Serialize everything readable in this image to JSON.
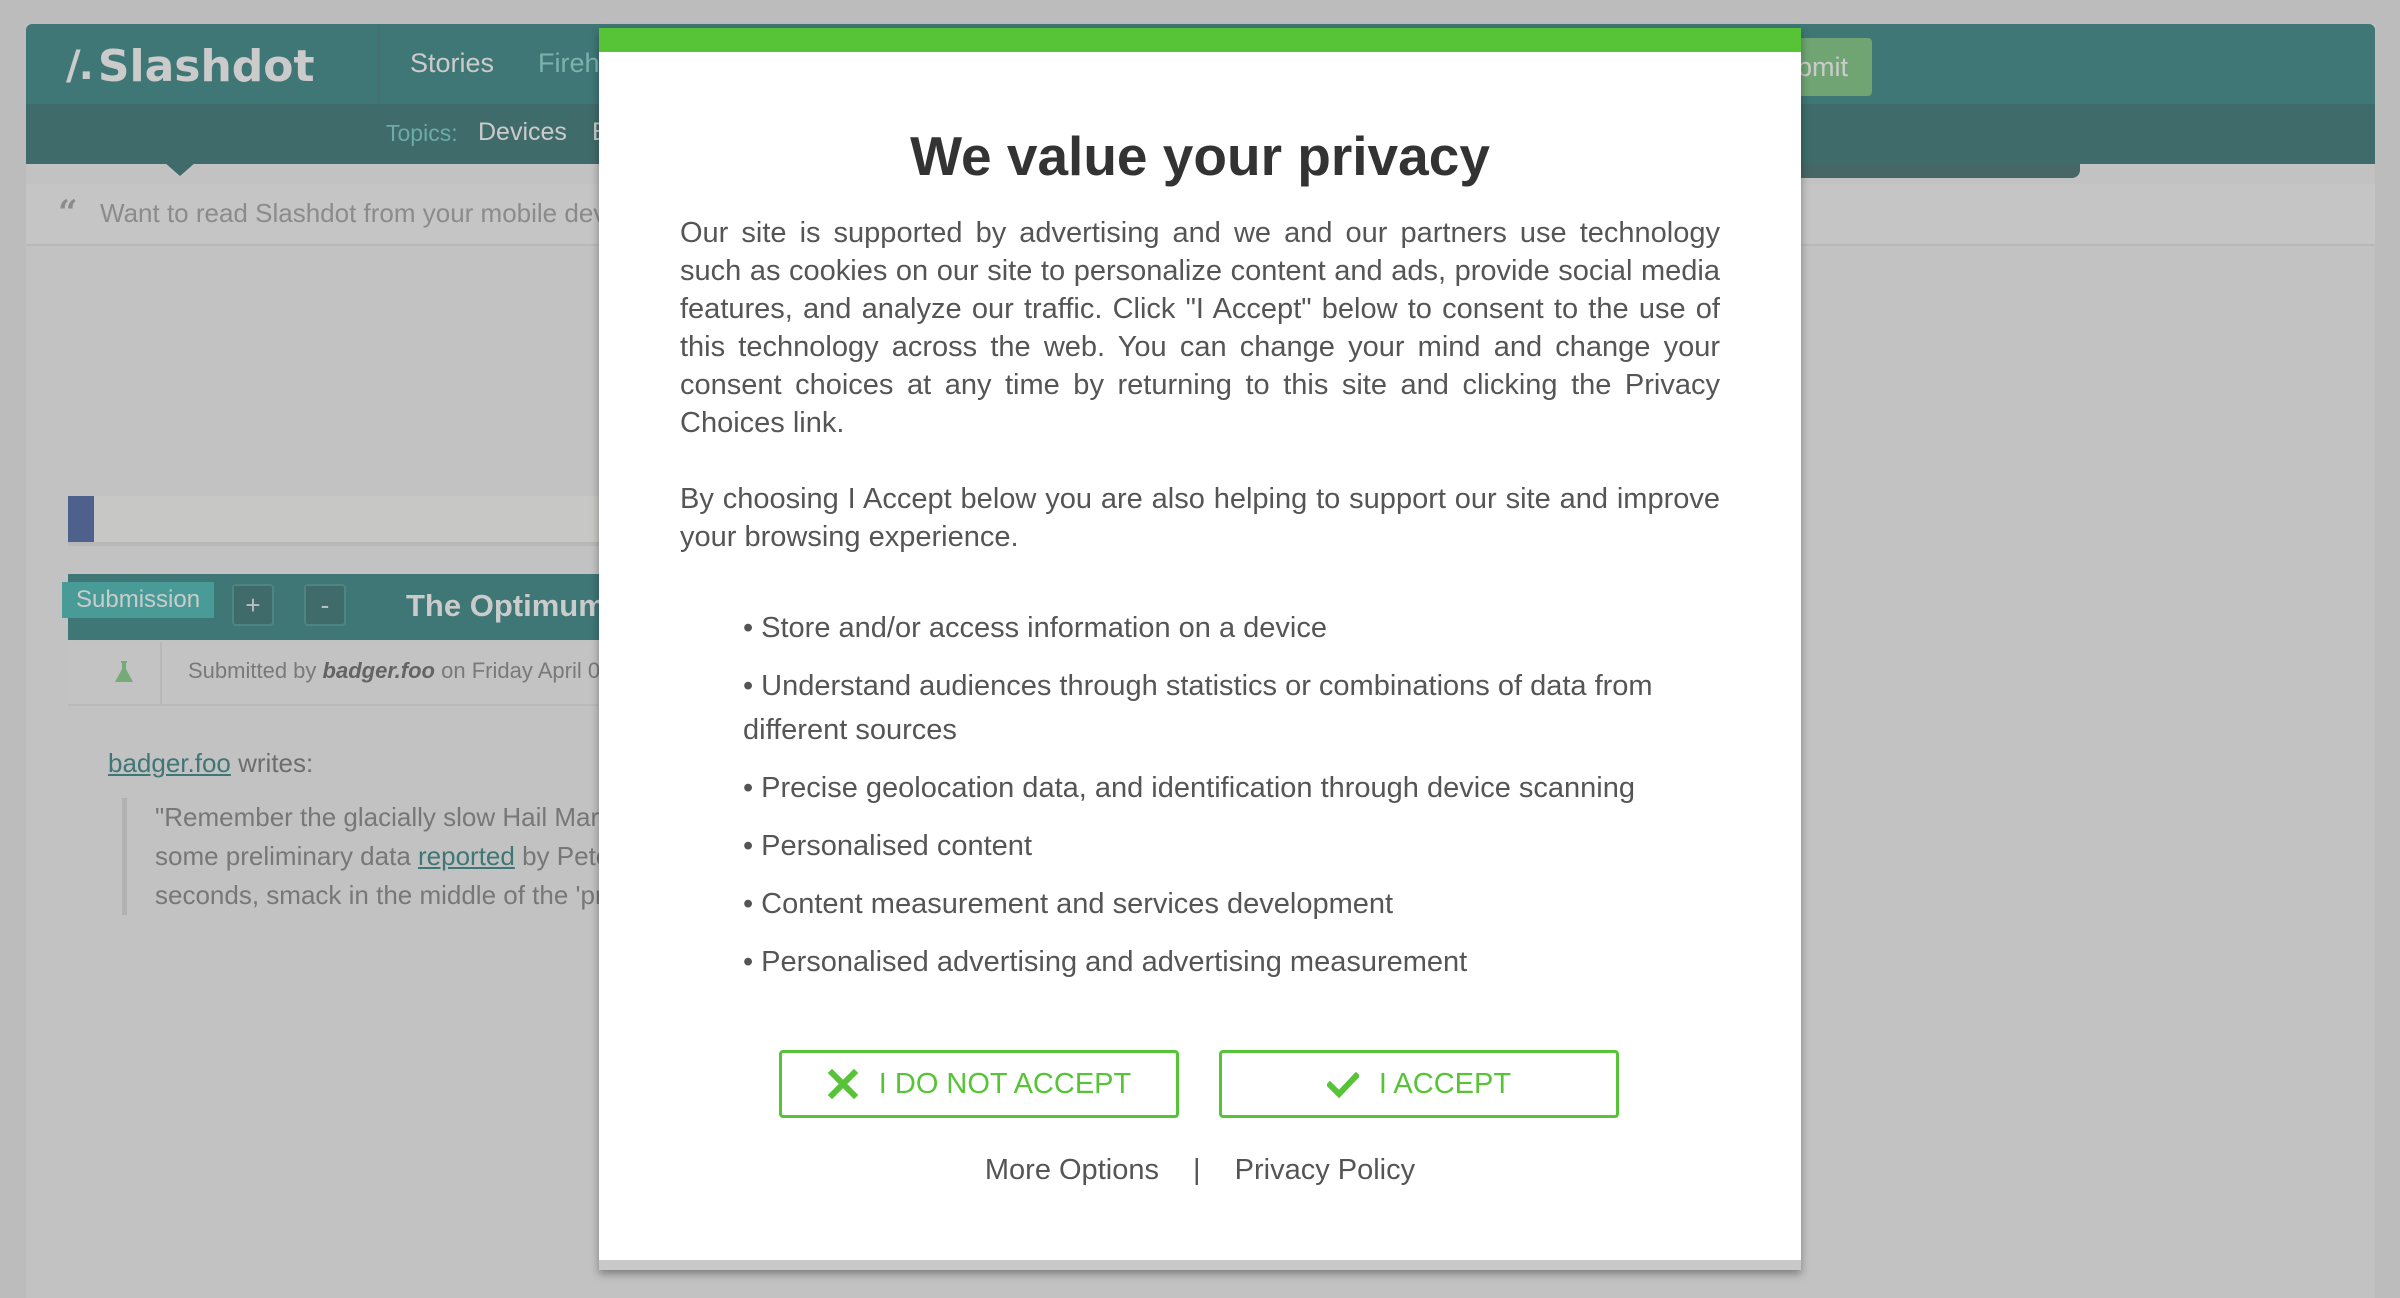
{
  "site": {
    "logo_text": "Slashdot",
    "nav": {
      "stories": "Stories",
      "firehose_partial": "Fireh",
      "submit_partial": "bmit"
    },
    "topics": {
      "label": "Topics:",
      "items": [
        "Devices",
        "B"
      ]
    },
    "mobile_bar_text": "Want to read Slashdot from your mobile dev",
    "story": {
      "tag": "Submission",
      "plus": "+",
      "minus": "-",
      "title_partial": "The Optimum",
      "meta_prefix": "Submitted by",
      "meta_author": "badger.foo",
      "meta_suffix": "on Friday April 0",
      "author_link": "badger.foo",
      "writes": "writes:",
      "quote_lines": [
        "\"Remember the glacially slow Hail Mar",
        "some preliminary data",
        "seconds, smack in the middle of the 'pr"
      ],
      "quote_link": "reported",
      "quote_after_link": "by Pete"
    }
  },
  "consent": {
    "title": "We value your privacy",
    "paragraph1": "Our site is supported by advertising and we and our partners use technology such as cookies on our site to personalize content and ads, provide social media features, and analyze our traffic. Click \"I Accept\" below to consent to the use of this technology across the web. You can change your mind and change your consent choices at any time by returning to this site and clicking the Privacy Choices link.",
    "paragraph2": "By choosing I Accept below you are also helping to support our site and improve your browsing experience.",
    "purposes": [
      "Store and/or access information on a device",
      "Understand audiences through statistics or combinations of data from different sources",
      "Precise geolocation data, and identification through device scanning",
      "Personalised content",
      "Content measurement and services development",
      "Personalised advertising and advertising measurement"
    ],
    "reject_label": "I DO NOT ACCEPT",
    "accept_label": "I ACCEPT",
    "more_options": "More Options",
    "separator": "|",
    "privacy_policy": "Privacy Policy",
    "colors": {
      "accent": "#57c437",
      "text": "#555555",
      "title": "#333333"
    },
    "icons": {
      "reject": "close-icon",
      "accept": "checkmark-icon"
    }
  }
}
